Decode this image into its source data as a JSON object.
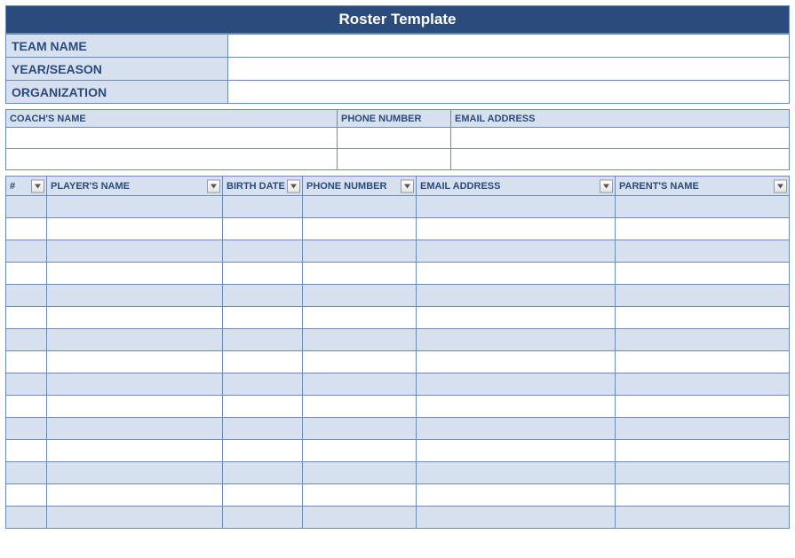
{
  "title": "Roster Template",
  "info": {
    "team_label": "TEAM NAME",
    "team_value": "",
    "year_label": "YEAR/SEASON",
    "year_value": "",
    "org_label": "ORGANIZATION",
    "org_value": ""
  },
  "coach": {
    "headers": {
      "name": "COACH'S NAME",
      "phone": "PHONE NUMBER",
      "email": "EMAIL ADDRESS"
    },
    "rows": [
      {
        "name": "",
        "phone": "",
        "email": ""
      },
      {
        "name": "",
        "phone": "",
        "email": ""
      }
    ]
  },
  "players": {
    "headers": {
      "num": "#",
      "name": "PLAYER'S NAME",
      "birth": "BIRTH DATE",
      "phone": "PHONE NUMBER",
      "email": "EMAIL ADDRESS",
      "parent": "PARENT'S NAME"
    },
    "rows": [
      {
        "num": "",
        "name": "",
        "birth": "",
        "phone": "",
        "email": "",
        "parent": ""
      },
      {
        "num": "",
        "name": "",
        "birth": "",
        "phone": "",
        "email": "",
        "parent": ""
      },
      {
        "num": "",
        "name": "",
        "birth": "",
        "phone": "",
        "email": "",
        "parent": ""
      },
      {
        "num": "",
        "name": "",
        "birth": "",
        "phone": "",
        "email": "",
        "parent": ""
      },
      {
        "num": "",
        "name": "",
        "birth": "",
        "phone": "",
        "email": "",
        "parent": ""
      },
      {
        "num": "",
        "name": "",
        "birth": "",
        "phone": "",
        "email": "",
        "parent": ""
      },
      {
        "num": "",
        "name": "",
        "birth": "",
        "phone": "",
        "email": "",
        "parent": ""
      },
      {
        "num": "",
        "name": "",
        "birth": "",
        "phone": "",
        "email": "",
        "parent": ""
      },
      {
        "num": "",
        "name": "",
        "birth": "",
        "phone": "",
        "email": "",
        "parent": ""
      },
      {
        "num": "",
        "name": "",
        "birth": "",
        "phone": "",
        "email": "",
        "parent": ""
      },
      {
        "num": "",
        "name": "",
        "birth": "",
        "phone": "",
        "email": "",
        "parent": ""
      },
      {
        "num": "",
        "name": "",
        "birth": "",
        "phone": "",
        "email": "",
        "parent": ""
      },
      {
        "num": "",
        "name": "",
        "birth": "",
        "phone": "",
        "email": "",
        "parent": ""
      },
      {
        "num": "",
        "name": "",
        "birth": "",
        "phone": "",
        "email": "",
        "parent": ""
      },
      {
        "num": "",
        "name": "",
        "birth": "",
        "phone": "",
        "email": "",
        "parent": ""
      }
    ]
  }
}
